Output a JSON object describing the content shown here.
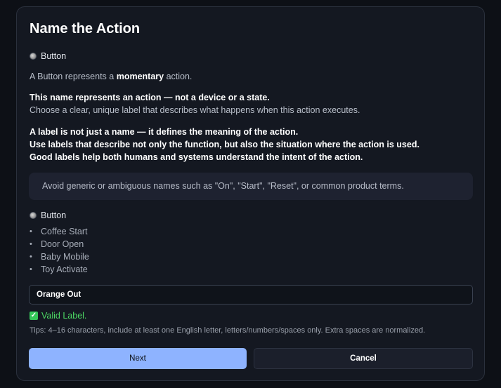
{
  "title": "Name the Action",
  "type_label": "Button",
  "intro": {
    "prefix": "A Button represents a ",
    "emphasis": "momentary",
    "suffix": " action."
  },
  "rule1": {
    "heading": "This name represents an action — not a device or a state.",
    "sub": "Choose a clear, unique label that describes what happens when this action executes."
  },
  "rule2": {
    "line1": "A label is not just a name — it defines the meaning of the action.",
    "line2": "Use labels that describe not only the function, but also the situation where the action is used.",
    "line3": "Good labels help both humans and systems understand the intent of the action."
  },
  "hint": "Avoid generic or ambiguous names such as \"On\", \"Start\", \"Reset\", or common product terms.",
  "examples_label": "Button",
  "examples": [
    "Coffee Start",
    "Door Open",
    "Baby Mobile",
    "Toy Activate"
  ],
  "input": {
    "value": "Orange Out"
  },
  "validation": {
    "icon": "check-icon",
    "text": "Valid Label."
  },
  "tips": "Tips: 4–16 characters, include at least one English letter, letters/numbers/spaces only. Extra spaces are normalized.",
  "buttons": {
    "next": "Next",
    "cancel": "Cancel"
  },
  "colors": {
    "accent": "#8eb3ff",
    "valid": "#4cd964",
    "background": "#141821"
  }
}
